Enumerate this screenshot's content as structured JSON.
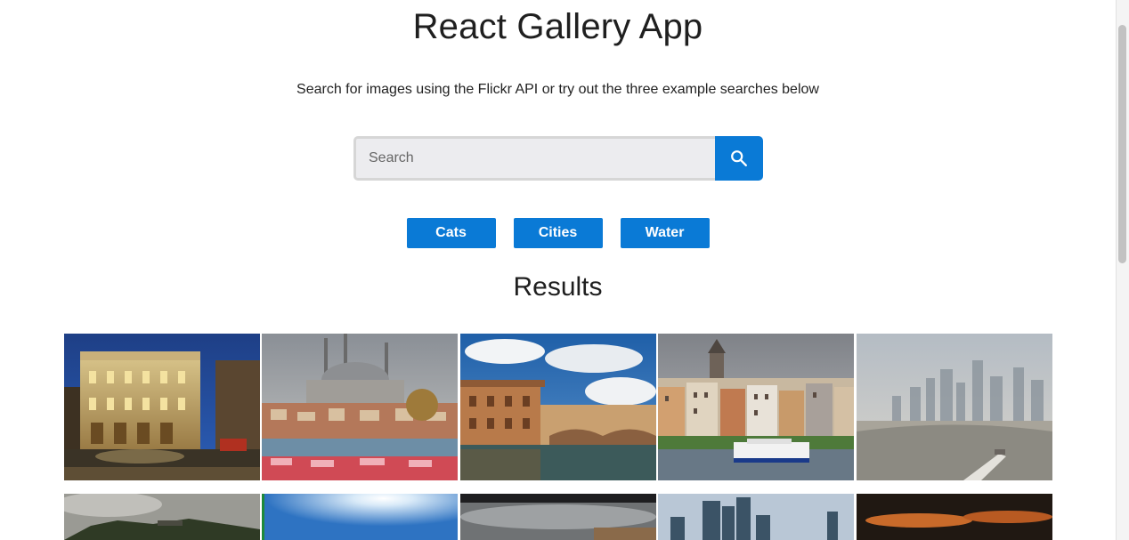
{
  "header": {
    "title": "React Gallery App",
    "subtitle": "Search for images using the Flickr API or try out the three example searches below"
  },
  "search": {
    "placeholder": "Search",
    "value": "",
    "button_icon": "search-icon"
  },
  "nav": {
    "items": [
      {
        "label": "Cats"
      },
      {
        "label": "Cities"
      },
      {
        "label": "Water"
      }
    ]
  },
  "results": {
    "heading": "Results",
    "photos": [
      {
        "icon": "photo-city-hall-night"
      },
      {
        "icon": "photo-istanbul-mosque"
      },
      {
        "icon": "photo-florence-river"
      },
      {
        "icon": "photo-galata-tower-ferry"
      },
      {
        "icon": "photo-foggy-skyline-river"
      },
      {
        "icon": "photo-hill-trees"
      },
      {
        "icon": "photo-sun-blue-sky"
      },
      {
        "icon": "photo-cloudy-rooftops"
      },
      {
        "icon": "photo-skyscrapers"
      },
      {
        "icon": "photo-sunset-clouds"
      }
    ]
  },
  "colors": {
    "accent": "#0a7ad6",
    "input_bg": "#ececef",
    "text": "#1f1f1f"
  }
}
